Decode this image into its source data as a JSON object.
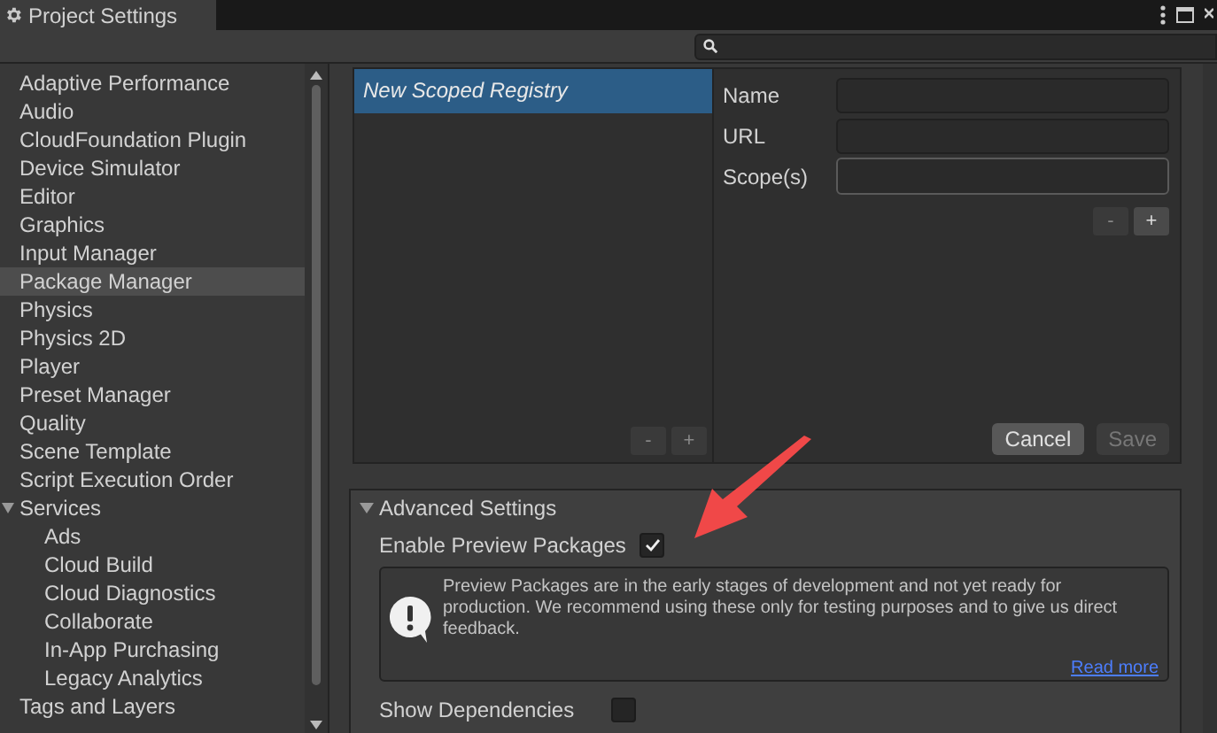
{
  "window": {
    "title": "Project Settings"
  },
  "sidebar": {
    "items": [
      {
        "label": "Adaptive Performance",
        "selected": false
      },
      {
        "label": "Audio",
        "selected": false
      },
      {
        "label": "CloudFoundation Plugin",
        "selected": false
      },
      {
        "label": "Device Simulator",
        "selected": false
      },
      {
        "label": "Editor",
        "selected": false
      },
      {
        "label": "Graphics",
        "selected": false
      },
      {
        "label": "Input Manager",
        "selected": false
      },
      {
        "label": "Package Manager",
        "selected": true
      },
      {
        "label": "Physics",
        "selected": false
      },
      {
        "label": "Physics 2D",
        "selected": false
      },
      {
        "label": "Player",
        "selected": false
      },
      {
        "label": "Preset Manager",
        "selected": false
      },
      {
        "label": "Quality",
        "selected": false
      },
      {
        "label": "Scene Template",
        "selected": false
      },
      {
        "label": "Script Execution Order",
        "selected": false
      },
      {
        "label": "Services",
        "selected": false,
        "expanded": true,
        "children": [
          {
            "label": "Ads",
            "selected": false
          },
          {
            "label": "Cloud Build",
            "selected": false
          },
          {
            "label": "Cloud Diagnostics",
            "selected": false
          },
          {
            "label": "Collaborate",
            "selected": false
          },
          {
            "label": "In-App Purchasing",
            "selected": false
          },
          {
            "label": "Legacy Analytics",
            "selected": false
          }
        ]
      },
      {
        "label": "Tags and Layers",
        "selected": false
      }
    ]
  },
  "registries": {
    "items": [
      {
        "label": "New Scoped Registry",
        "selected": true
      }
    ],
    "list_buttons": [
      "-",
      "+"
    ],
    "fields": [
      {
        "label": "Name",
        "focused": false
      },
      {
        "label": "URL",
        "focused": false
      },
      {
        "label": "Scope(s)",
        "focused": true
      }
    ],
    "scope_buttons": [
      "-",
      "+"
    ],
    "actions": [
      {
        "label": "Cancel",
        "disabled": false
      },
      {
        "label": "Save",
        "disabled": true
      }
    ]
  },
  "advanced": {
    "title": "Advanced Settings",
    "expanded": true,
    "enable_preview": {
      "label": "Enable Preview Packages",
      "checked": true
    },
    "notice": {
      "text": "Preview Packages are in the early stages of development and not yet ready for production. We recommend using these only for testing purposes and to give us direct feedback.",
      "link": "Read more"
    },
    "show_dependencies": {
      "label": "Show Dependencies",
      "checked": false
    }
  }
}
